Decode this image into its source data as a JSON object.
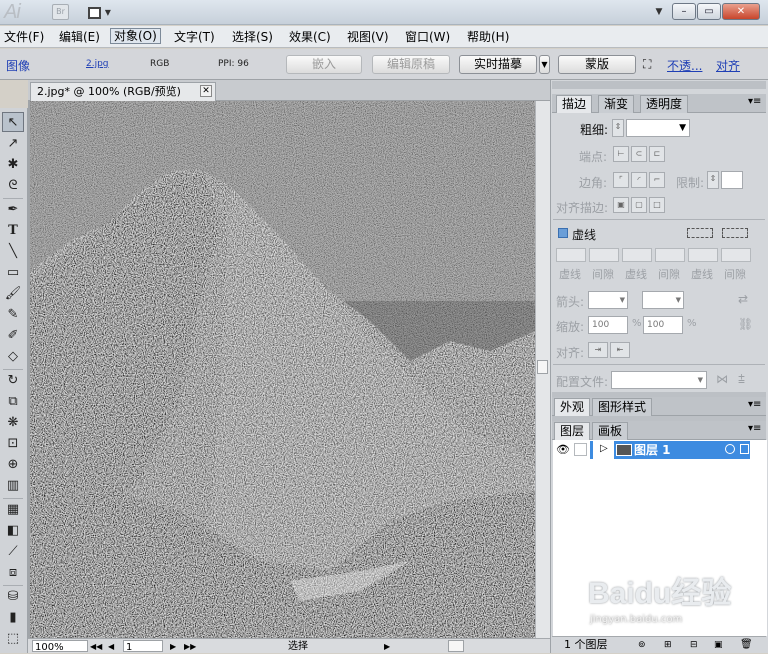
{
  "titlebar": {
    "app_logo": "Ai",
    "bridge_label": "Br",
    "window_controls": [
      "–",
      "▭",
      "✕"
    ]
  },
  "menubar": {
    "items": [
      {
        "label": "文件(F)"
      },
      {
        "label": "编辑(E)"
      },
      {
        "label": "对象(O)"
      },
      {
        "label": "文字(T)"
      },
      {
        "label": "选择(S)"
      },
      {
        "label": "效果(C)"
      },
      {
        "label": "视图(V)"
      },
      {
        "label": "窗口(W)"
      },
      {
        "label": "帮助(H)"
      }
    ]
  },
  "controlbar": {
    "object_type": "图像",
    "filename": "2.jpg",
    "color_mode": "RGB",
    "ppi": "PPI: 96",
    "embed_label": "嵌入",
    "edit_original_label": "编辑原稿",
    "live_trace_label": "实时描摹",
    "mask_label": "蒙版",
    "opacity_label": "不透...",
    "align_label": "对齐"
  },
  "document": {
    "tab_title": "2.jpg* @ 100% (RGB/预览)",
    "close_glyph": "✕"
  },
  "statusbar": {
    "zoom": "100%",
    "page": "1",
    "mode": "选择"
  },
  "panels": {
    "stroke_tabs": [
      "描边",
      "渐变",
      "透明度"
    ],
    "weight_label": "粗细:",
    "cap_label": "端点:",
    "corner_label": "边角:",
    "limit_label": "限制:",
    "align_stroke_label": "对齐描边:",
    "dashed_label": "虚线",
    "dash_labels": [
      "虚线",
      "间隙",
      "虚线",
      "间隙",
      "虚线",
      "间隙"
    ],
    "arrow_label": "箭头:",
    "scale_label": "缩放:",
    "scale_values": [
      "100",
      "100"
    ],
    "percent": "%",
    "align_label": "对齐:",
    "profile_label": "配置文件:",
    "appearance_tabs": [
      "外观",
      "图形样式"
    ],
    "layer_tabs": [
      "图层",
      "画板"
    ],
    "layer_name": "图层 1",
    "layer_count": "1 个图层"
  },
  "watermark": {
    "brand": "Baidu经验",
    "url": "jingyan.baidu.com"
  },
  "colors": {
    "layer_selected": "#3d8be0",
    "link": "#1f3fb5",
    "close_button": "#c8452b"
  }
}
